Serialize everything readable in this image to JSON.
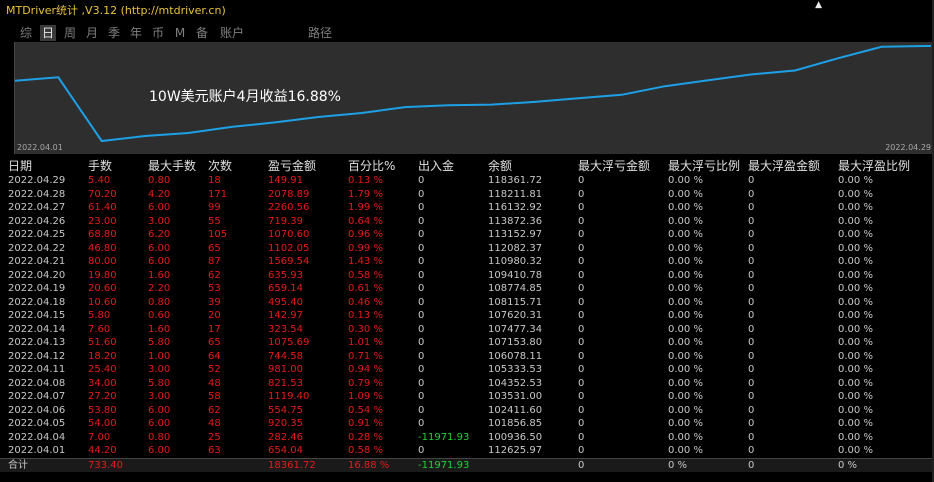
{
  "window": {
    "title": "MTDriver统计 ,V3.12 (http://mtdriver.cn)",
    "pin_glyph": "▲"
  },
  "tabs": [
    {
      "label": "综",
      "active": false
    },
    {
      "label": "日",
      "active": true
    },
    {
      "label": "周",
      "active": false
    },
    {
      "label": "月",
      "active": false
    },
    {
      "label": "季",
      "active": false
    },
    {
      "label": "年",
      "active": false
    },
    {
      "label": "币",
      "active": false
    },
    {
      "label": "M",
      "active": false
    },
    {
      "label": "备",
      "active": false
    },
    {
      "label": "账户",
      "active": false
    },
    {
      "label": "路径",
      "active": false
    }
  ],
  "chart": {
    "title": "10W美元账户4月收益16.88%",
    "date_start": "2022.04.01",
    "date_end": "2022.04.29",
    "line_color": "#1ea0e6",
    "background": "#2e2e2e"
  },
  "table": {
    "columns": [
      "日期",
      "手数",
      "最大手数",
      "次数",
      "盈亏金额",
      "百分比%",
      "出入金",
      "余额",
      "最大浮亏金额",
      "最大浮亏比例",
      "最大浮盈金额",
      "最大浮盈比例"
    ],
    "rows": [
      [
        "2022.04.29",
        "5.40",
        "0.80",
        "18",
        "149.91",
        "0.13 %",
        "0",
        "118361.72",
        "0",
        "0.00 %",
        "0",
        "0.00 %"
      ],
      [
        "2022.04.28",
        "70.20",
        "4.20",
        "171",
        "2078.89",
        "1.79 %",
        "0",
        "118211.81",
        "0",
        "0.00 %",
        "0",
        "0.00 %"
      ],
      [
        "2022.04.27",
        "61.40",
        "6.00",
        "99",
        "2260.56",
        "1.99 %",
        "0",
        "116132.92",
        "0",
        "0.00 %",
        "0",
        "0.00 %"
      ],
      [
        "2022.04.26",
        "23.00",
        "3.00",
        "55",
        "719.39",
        "0.64 %",
        "0",
        "113872.36",
        "0",
        "0.00 %",
        "0",
        "0.00 %"
      ],
      [
        "2022.04.25",
        "68.80",
        "6.20",
        "105",
        "1070.60",
        "0.96 %",
        "0",
        "113152.97",
        "0",
        "0.00 %",
        "0",
        "0.00 %"
      ],
      [
        "2022.04.22",
        "46.80",
        "6.00",
        "65",
        "1102.05",
        "0.99 %",
        "0",
        "112082.37",
        "0",
        "0.00 %",
        "0",
        "0.00 %"
      ],
      [
        "2022.04.21",
        "80.00",
        "6.00",
        "87",
        "1569.54",
        "1.43 %",
        "0",
        "110980.32",
        "0",
        "0.00 %",
        "0",
        "0.00 %"
      ],
      [
        "2022.04.20",
        "19.80",
        "1.60",
        "62",
        "635.93",
        "0.58 %",
        "0",
        "109410.78",
        "0",
        "0.00 %",
        "0",
        "0.00 %"
      ],
      [
        "2022.04.19",
        "20.60",
        "2.20",
        "53",
        "659.14",
        "0.61 %",
        "0",
        "108774.85",
        "0",
        "0.00 %",
        "0",
        "0.00 %"
      ],
      [
        "2022.04.18",
        "10.60",
        "0.80",
        "39",
        "495.40",
        "0.46 %",
        "0",
        "108115.71",
        "0",
        "0.00 %",
        "0",
        "0.00 %"
      ],
      [
        "2022.04.15",
        "5.80",
        "0.60",
        "20",
        "142.97",
        "0.13 %",
        "0",
        "107620.31",
        "0",
        "0.00 %",
        "0",
        "0.00 %"
      ],
      [
        "2022.04.14",
        "7.60",
        "1.60",
        "17",
        "323.54",
        "0.30 %",
        "0",
        "107477.34",
        "0",
        "0.00 %",
        "0",
        "0.00 %"
      ],
      [
        "2022.04.13",
        "51.60",
        "5.80",
        "65",
        "1075.69",
        "1.01 %",
        "0",
        "107153.80",
        "0",
        "0.00 %",
        "0",
        "0.00 %"
      ],
      [
        "2022.04.12",
        "18.20",
        "1.00",
        "64",
        "744.58",
        "0.71 %",
        "0",
        "106078.11",
        "0",
        "0.00 %",
        "0",
        "0.00 %"
      ],
      [
        "2022.04.11",
        "25.40",
        "3.00",
        "52",
        "981.00",
        "0.94 %",
        "0",
        "105333.53",
        "0",
        "0.00 %",
        "0",
        "0.00 %"
      ],
      [
        "2022.04.08",
        "34.00",
        "5.80",
        "48",
        "821.53",
        "0.79 %",
        "0",
        "104352.53",
        "0",
        "0.00 %",
        "0",
        "0.00 %"
      ],
      [
        "2022.04.07",
        "27.20",
        "3.00",
        "58",
        "1119.40",
        "1.09 %",
        "0",
        "103531.00",
        "0",
        "0.00 %",
        "0",
        "0.00 %"
      ],
      [
        "2022.04.06",
        "53.80",
        "6.00",
        "62",
        "554.75",
        "0.54 %",
        "0",
        "102411.60",
        "0",
        "0.00 %",
        "0",
        "0.00 %"
      ],
      [
        "2022.04.05",
        "54.00",
        "6.00",
        "48",
        "920.35",
        "0.91 %",
        "0",
        "101856.85",
        "0",
        "0.00 %",
        "0",
        "0.00 %"
      ],
      [
        "2022.04.04",
        "7.00",
        "0.80",
        "25",
        "282.46",
        "0.28 %",
        "-11971.93",
        "100936.50",
        "0",
        "0.00 %",
        "0",
        "0.00 %"
      ],
      [
        "2022.04.01",
        "44.20",
        "6.00",
        "63",
        "654.04",
        "0.58 %",
        "0",
        "112625.97",
        "0",
        "0.00 %",
        "0",
        "0.00 %"
      ]
    ],
    "total": [
      "合计",
      "733.40",
      "",
      "",
      "18361.72",
      "16.88 %",
      "-11971.93",
      "",
      "0",
      "0 %",
      "0",
      "0 %"
    ]
  },
  "colors": {
    "profit": "#e81a1a",
    "deposit_negative": "#1fd33a",
    "title": "#e8c33a"
  }
}
